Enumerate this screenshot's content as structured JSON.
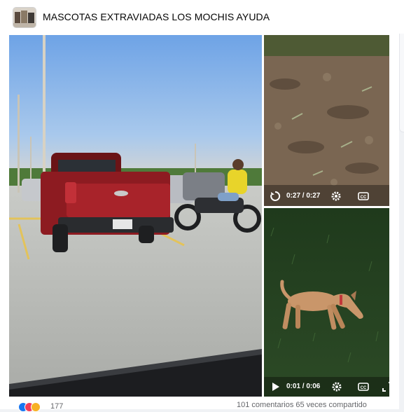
{
  "group": {
    "title": "MASCOTAS EXTRAVIADAS LOS MOCHIS AYUDA",
    "avatar_icon": "group-avatar"
  },
  "media": [
    {
      "kind": "photo",
      "description_icon": "parking-lot-photo"
    },
    {
      "kind": "video",
      "time": "0:27 / 0:27",
      "state": "ended",
      "icons": [
        "replay-icon",
        "settings-icon",
        "captions-icon"
      ]
    },
    {
      "kind": "video",
      "time": "0:01 / 0:06",
      "state": "paused",
      "icons": [
        "play-icon",
        "settings-icon",
        "captions-icon",
        "fullscreen-icon"
      ]
    }
  ],
  "footer": {
    "reaction_count": "177",
    "engagement": "101 comentarios  65 veces compartido"
  },
  "colors": {
    "like": "#1877f2",
    "love": "#f33e58",
    "care": "#f7b125"
  }
}
